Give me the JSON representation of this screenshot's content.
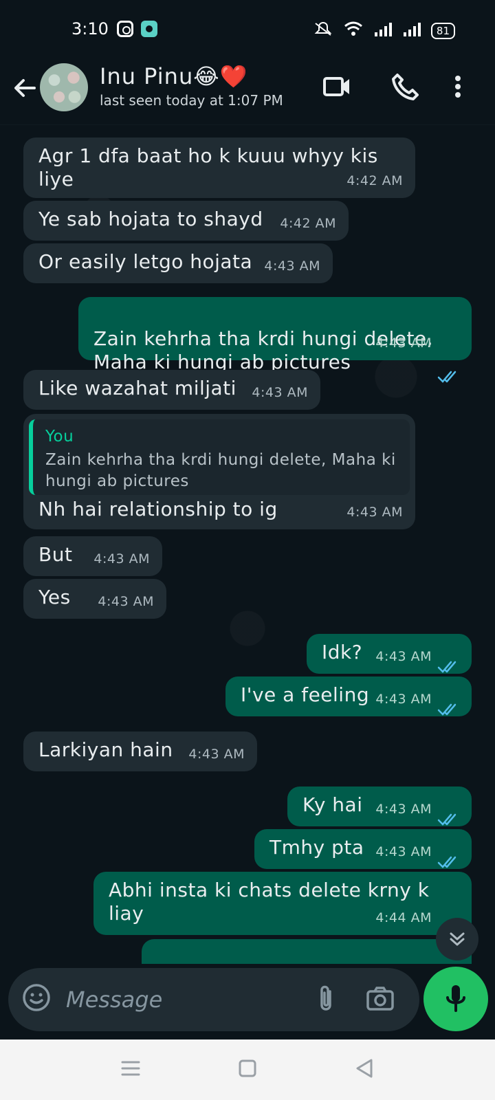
{
  "status_bar": {
    "time": "3:10",
    "battery": "81",
    "icons": [
      "instagram-icon",
      "app-icon",
      "mute-icon",
      "wifi-icon",
      "signal-icon",
      "signal-icon",
      "battery-icon"
    ]
  },
  "header": {
    "contact_name": "Inu Pinu😂❤️",
    "last_seen": "last seen today at 1:07 PM",
    "icons": [
      "back-arrow-icon",
      "video-call-icon",
      "phone-icon",
      "more-vert-icon"
    ]
  },
  "messages": [
    {
      "direction": "in",
      "text": "Agr 1 dfa baat ho k kuuu whyy kis liye",
      "time": "4:42 AM"
    },
    {
      "direction": "in",
      "text": "Ye sab hojata to shayd",
      "time": "4:42 AM"
    },
    {
      "direction": "in",
      "text": "Or easily letgo hojata",
      "time": "4:43 AM"
    },
    {
      "direction": "out",
      "text": "Zain kehrha tha krdi hungi delete,\nMaha ki hungi ab pictures",
      "time": "4:43 AM",
      "status": "read"
    },
    {
      "direction": "in",
      "text": "Like wazahat miljati",
      "time": "4:43 AM"
    },
    {
      "direction": "in",
      "reply_author": "You",
      "reply_text": "Zain kehrha tha krdi hungi delete, Maha ki hungi ab pictures",
      "text": "Nh hai relationship to ig",
      "time": "4:43 AM"
    },
    {
      "direction": "in",
      "text": "But",
      "time": "4:43 AM"
    },
    {
      "direction": "in",
      "text": "Yes",
      "time": "4:43 AM"
    },
    {
      "direction": "out",
      "text": "Idk?",
      "time": "4:43 AM",
      "status": "read"
    },
    {
      "direction": "out",
      "text": "I've a feeling",
      "time": "4:43 AM",
      "status": "read"
    },
    {
      "direction": "in",
      "text": "Larkiyan hain",
      "time": "4:43 AM"
    },
    {
      "direction": "out",
      "text": "Ky hai",
      "time": "4:43 AM",
      "status": "read"
    },
    {
      "direction": "out",
      "text": "Tmhy pta",
      "time": "4:43 AM",
      "status": "read"
    },
    {
      "direction": "out",
      "text": "Abhi insta ki chats delete krny k liay",
      "time": "4:44 AM",
      "status": "read"
    },
    {
      "direction": "out",
      "text": "",
      "time": "",
      "status": "partial"
    }
  ],
  "compose": {
    "placeholder": "Message",
    "icons": [
      "emoji-icon",
      "attachment-icon",
      "camera-icon",
      "mic-icon"
    ]
  },
  "navigation": {
    "icons": [
      "menu-icon",
      "home-icon",
      "back-icon"
    ]
  },
  "colors": {
    "background": "#0b141a",
    "incoming_bubble": "#202c33",
    "outgoing_bubble": "#005c4b",
    "accent": "#21c063",
    "read_ticks": "#53bdeb"
  }
}
